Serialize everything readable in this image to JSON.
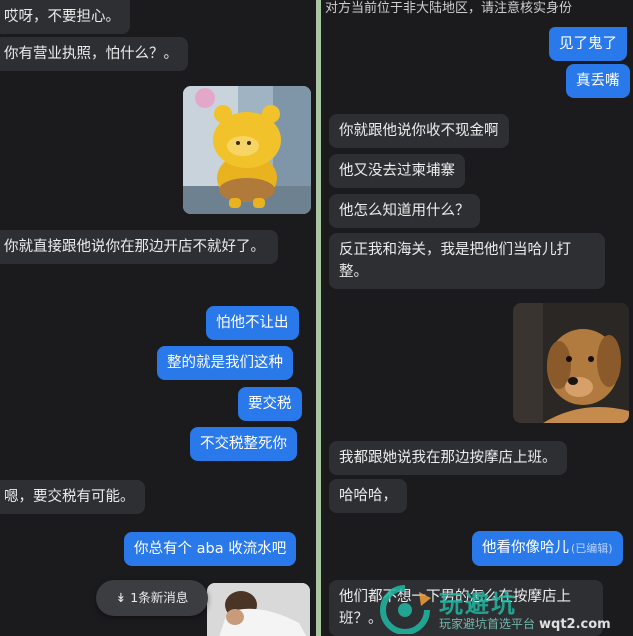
{
  "left": {
    "messages": [
      {
        "text": "哎呀，不要担心。"
      },
      {
        "text": "你有营业执照，怕什么？。"
      },
      {
        "text": "你就直接跟他说你在那边开店不就好了。"
      },
      {
        "text": "怕他不让出"
      },
      {
        "text": "整的就是我们这种"
      },
      {
        "text": "要交税"
      },
      {
        "text": "不交税整死你"
      },
      {
        "text": "嗯，要交税有可能。"
      },
      {
        "text": "你总有个 aba 收流水吧"
      }
    ],
    "new_messages_pill": {
      "icon": "double-chevron-down",
      "label": "1条新消息"
    }
  },
  "right": {
    "notice": "对方当前位于非大陆地区，请注意核实身份",
    "messages": [
      {
        "text": "见了鬼了"
      },
      {
        "text": "真丢嘴"
      },
      {
        "text": "你就跟他说你收不现金啊"
      },
      {
        "text": "他又没去过柬埔寨"
      },
      {
        "text": "他怎么知道用什么？"
      },
      {
        "text": "反正我和海关，我是把他们当哈儿打整。"
      },
      {
        "text": "我都跟她说我在那边按摩店上班。"
      },
      {
        "text": "哈哈哈，"
      },
      {
        "text": "他看你像哈儿",
        "tag": "(已编辑)"
      },
      {
        "text": "他们都不想一下男的怎么在按摩店上班？。"
      }
    ]
  },
  "watermark": {
    "brand": "玩避坑",
    "slogan": "玩家避坑首选平台",
    "url": "wqt2.com"
  },
  "colors": {
    "sent_bubble": "#2a79ea",
    "recv_bubble": "#2e2f33",
    "chat_bg": "#1b1b1d",
    "divider": "#a9c8a2"
  }
}
